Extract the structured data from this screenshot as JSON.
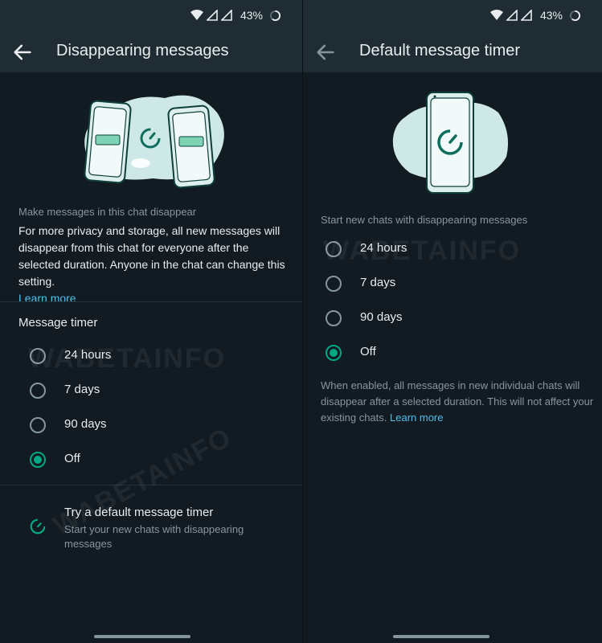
{
  "status": {
    "battery": "43%"
  },
  "left": {
    "title": "Disappearing messages",
    "intro_heading": "Make messages in this chat disappear",
    "intro_body": "For more privacy and storage, all new messages will disappear from this chat for everyone after the selected duration. Anyone in the chat can change this setting.",
    "learn_more": "Learn more",
    "section_title": "Message timer",
    "options": [
      {
        "label": "24 hours",
        "selected": false
      },
      {
        "label": "7 days",
        "selected": false
      },
      {
        "label": "90 days",
        "selected": false
      },
      {
        "label": "Off",
        "selected": true
      }
    ],
    "try_title": "Try a default message timer",
    "try_subtitle": "Start your new chats with disappearing messages"
  },
  "right": {
    "title": "Default message timer",
    "intro": "Start new chats with disappearing messages",
    "options": [
      {
        "label": "24 hours",
        "selected": false
      },
      {
        "label": "7 days",
        "selected": false
      },
      {
        "label": "90 days",
        "selected": false
      },
      {
        "label": "Off",
        "selected": true
      }
    ],
    "help_text": "When enabled, all messages in new individual chats will disappear after a selected duration. This will not affect your existing chats.",
    "learn_more": "Learn more"
  },
  "watermark": "WABETAINFO",
  "colors": {
    "accent": "#00a884",
    "link": "#53bdeb",
    "bar": "#1f2c33",
    "background": "#121b22"
  }
}
